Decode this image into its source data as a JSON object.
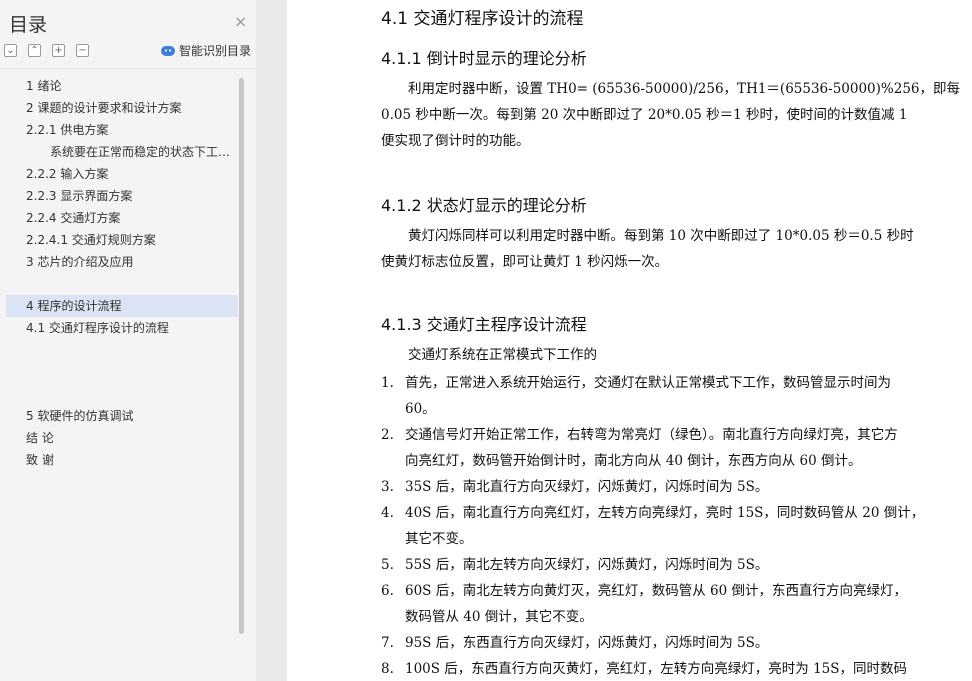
{
  "sidebar": {
    "title": "目录",
    "close_label": "×",
    "tool_collapse": "⌄",
    "tool_expand": "⌃",
    "tool_plus": "+",
    "tool_minus": "−",
    "smart_label": "智能识别目录",
    "toc": [
      {
        "label": "1   绪论",
        "level": 1
      },
      {
        "label": "2   课题的设计要求和设计方案",
        "level": 1
      },
      {
        "label": "2.2.1  供电方案",
        "level": 1
      },
      {
        "label": "系统要在正常而稳定的状态下工作，",
        "level": 3
      },
      {
        "label": "2.2.2  输入方案",
        "level": 1
      },
      {
        "label": "2.2.3  显示界面方案",
        "level": 1
      },
      {
        "label": "2.2.4 交通灯方案",
        "level": 1
      },
      {
        "label": "2.2.4.1 交通灯规则方案",
        "level": 1
      },
      {
        "label": "3   芯片的介绍及应用",
        "level": 1
      },
      {
        "label": "4   程序的设计流程",
        "level": 1,
        "selected": true
      },
      {
        "label": "4.1  交通灯程序设计的流程",
        "level": 1
      },
      {
        "label": "5   软硬件的仿真调试",
        "level": 1
      },
      {
        "label": "结  论",
        "level": 1
      },
      {
        "label": "致  谢",
        "level": 1
      }
    ]
  },
  "doc": {
    "h41": "4.1  交通灯程序设计的流程",
    "h411": "4.1.1 倒计时显示的理论分析",
    "p411_1": "利用定时器中断，设置  TH0= (65536-50000)/256，TH1＝(65536-50000)%256，即每",
    "p411_2": "0.05 秒中断一次。每到第 20 次中断即过了 20*0.05 秒＝1 秒时，使时间的计数值减 1",
    "p411_3": "便实现了倒计时的功能。",
    "h412": "4.1.2 状态灯显示的理论分析",
    "p412_1": "黄灯闪烁同样可以利用定时器中断。每到第 10 次中断即过了 10*0.05 秒＝0.5 秒时",
    "p412_2": "使黄灯标志位反置，即可让黄灯 1 秒闪烁一次。",
    "h413": "4.1.3  交通灯主程序设计流程",
    "p413": "交通灯系统在正常模式下工作的",
    "list": [
      {
        "num": "1.",
        "lines": [
          "首先，正常进入系统开始运行，交通灯在默认正常模式下工作，数码管显示时间为",
          "60。"
        ]
      },
      {
        "num": "2.",
        "lines": [
          "交通信号灯开始正常工作，右转弯为常亮灯（绿色）。南北直行方向绿灯亮，其它方",
          "向亮红灯，数码管开始倒计时，南北方向从 40 倒计，东西方向从 60 倒计。"
        ]
      },
      {
        "num": "3.",
        "lines": [
          "35S 后，南北直行方向灭绿灯，闪烁黄灯，闪烁时间为 5S。"
        ]
      },
      {
        "num": "4.",
        "lines": [
          "40S 后，南北直行方向亮红灯，左转方向亮绿灯，亮时 15S，同时数码管从 20 倒计，",
          "其它不变。"
        ]
      },
      {
        "num": "5.",
        "lines": [
          "55S 后，南北左转方向灭绿灯，闪烁黄灯，闪烁时间为 5S。"
        ]
      },
      {
        "num": "6.",
        "lines": [
          "60S 后，南北左转方向黄灯灭，亮红灯，数码管从 60 倒计，东西直行方向亮绿灯，",
          "数码管从 40 倒计，其它不变。"
        ]
      },
      {
        "num": "7.",
        "lines": [
          "95S 后，东西直行方向灭绿灯，闪烁黄灯，闪烁时间为 5S。"
        ]
      },
      {
        "num": "8.",
        "lines": [
          "100S 后，东西直行方向灭黄灯，亮红灯，左转方向亮绿灯，亮时为 15S，同时数码"
        ]
      }
    ]
  }
}
